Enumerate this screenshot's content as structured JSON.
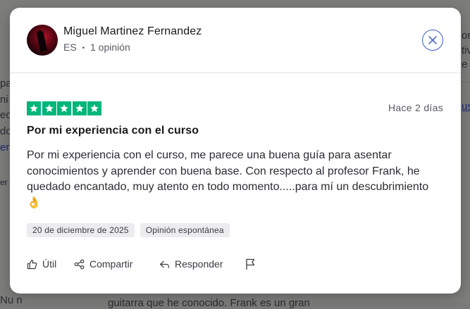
{
  "background": {
    "fragments": [
      "pa",
      "ni",
      "ec",
      "do",
      "er m",
      "er",
      "ont",
      "tiva",
      "e re",
      "us"
    ],
    "bottom_left": "Nu n",
    "bottom_center": "guitarra que he conocido. Frank es un gran"
  },
  "review": {
    "author": {
      "name": "Miguel Martinez Fernandez",
      "country": "ES",
      "separator": "•",
      "review_count": "1 opinión"
    },
    "rating": 5,
    "date_relative": "Hace 2 días",
    "title": "Por mi experiencia con el curso",
    "body": "Por mi experiencia con el curso, me parece una buena guía para asentar conocimientos y aprender con buena base. Con respecto al profesor Frank, he quedado encantado, muy atento en todo momento.....para mí un descubrimiento 👌",
    "tags": [
      "20 de diciembre de 2025",
      "Opinión espontánea"
    ],
    "actions": {
      "useful": "Útil",
      "share": "Compartir",
      "reply": "Responder"
    }
  },
  "colors": {
    "star_green": "#00b67a",
    "close_accent": "#3a59c6"
  },
  "icons": [
    "close-icon",
    "star-icon",
    "thumbs-up-icon",
    "share-icon",
    "reply-icon",
    "flag-icon"
  ]
}
